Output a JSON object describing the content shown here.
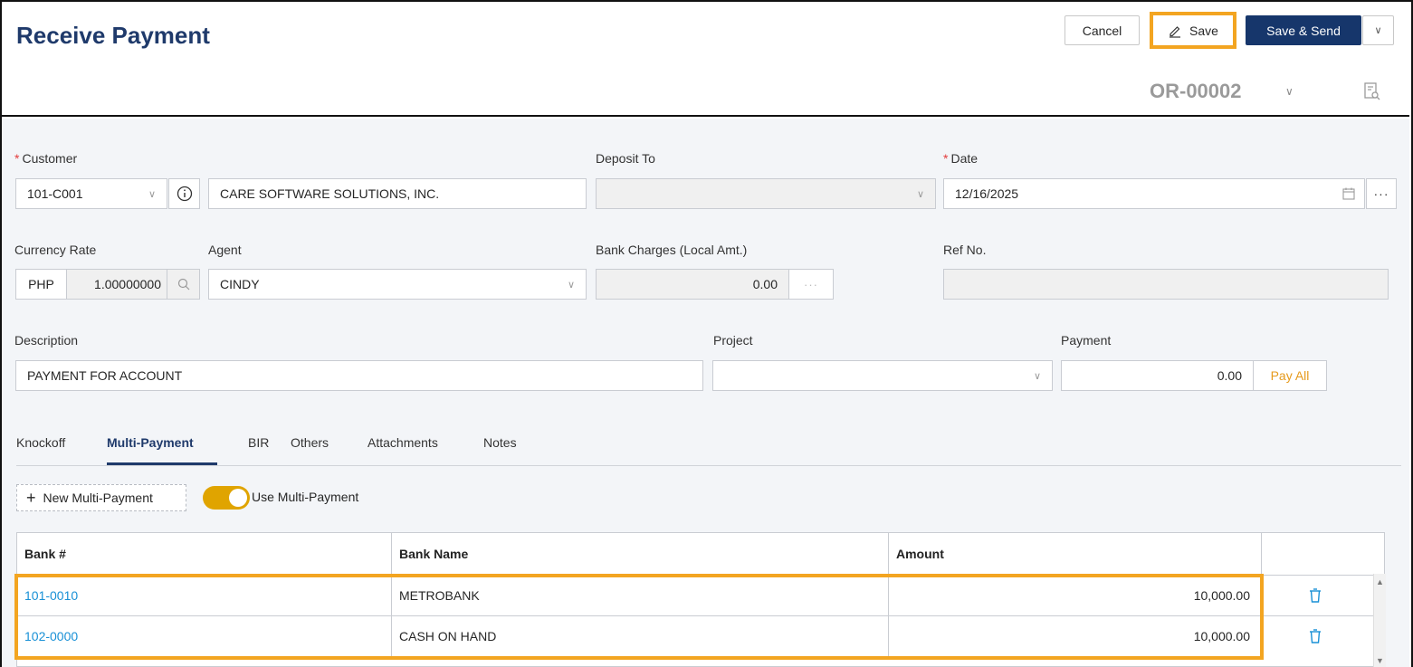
{
  "header": {
    "title": "Receive Payment",
    "cancel_label": "Cancel",
    "save_label": "Save",
    "save_send_label": "Save & Send",
    "doc_number": "OR-00002"
  },
  "form": {
    "customer": {
      "label": "Customer",
      "code": "101-C001",
      "name": "CARE SOFTWARE SOLUTIONS, INC."
    },
    "deposit_to": {
      "label": "Deposit To",
      "value": ""
    },
    "date": {
      "label": "Date",
      "value": "12/16/2025"
    },
    "currency_rate": {
      "label": "Currency Rate",
      "currency": "PHP",
      "rate": "1.00000000"
    },
    "agent": {
      "label": "Agent",
      "value": "CINDY"
    },
    "bank_charges": {
      "label": "Bank Charges (Local Amt.)",
      "value": "0.00"
    },
    "ref_no": {
      "label": "Ref No.",
      "value": ""
    },
    "description": {
      "label": "Description",
      "value": "PAYMENT FOR ACCOUNT"
    },
    "project": {
      "label": "Project",
      "value": ""
    },
    "payment": {
      "label": "Payment",
      "value": "0.00",
      "pay_all_label": "Pay All"
    }
  },
  "tabs": [
    {
      "label": "Knockoff"
    },
    {
      "label": "Multi-Payment"
    },
    {
      "label": "BIR"
    },
    {
      "label": "Others"
    },
    {
      "label": "Attachments"
    },
    {
      "label": "Notes"
    }
  ],
  "multi_payment": {
    "new_label": "New Multi-Payment",
    "toggle_label": "Use Multi-Payment",
    "toggle_on": true,
    "columns": [
      "Bank #",
      "Bank Name",
      "Amount"
    ],
    "rows": [
      {
        "bank_no": "101-0010",
        "bank_name": "METROBANK",
        "amount": "10,000.00"
      },
      {
        "bank_no": "102-0000",
        "bank_name": "CASH ON HAND",
        "amount": "10,000.00"
      }
    ]
  },
  "colors": {
    "primary": "#16366b",
    "highlight": "#f3a521",
    "link": "#1890d6",
    "toggle": "#e0a400",
    "required": "#e33b3b"
  }
}
